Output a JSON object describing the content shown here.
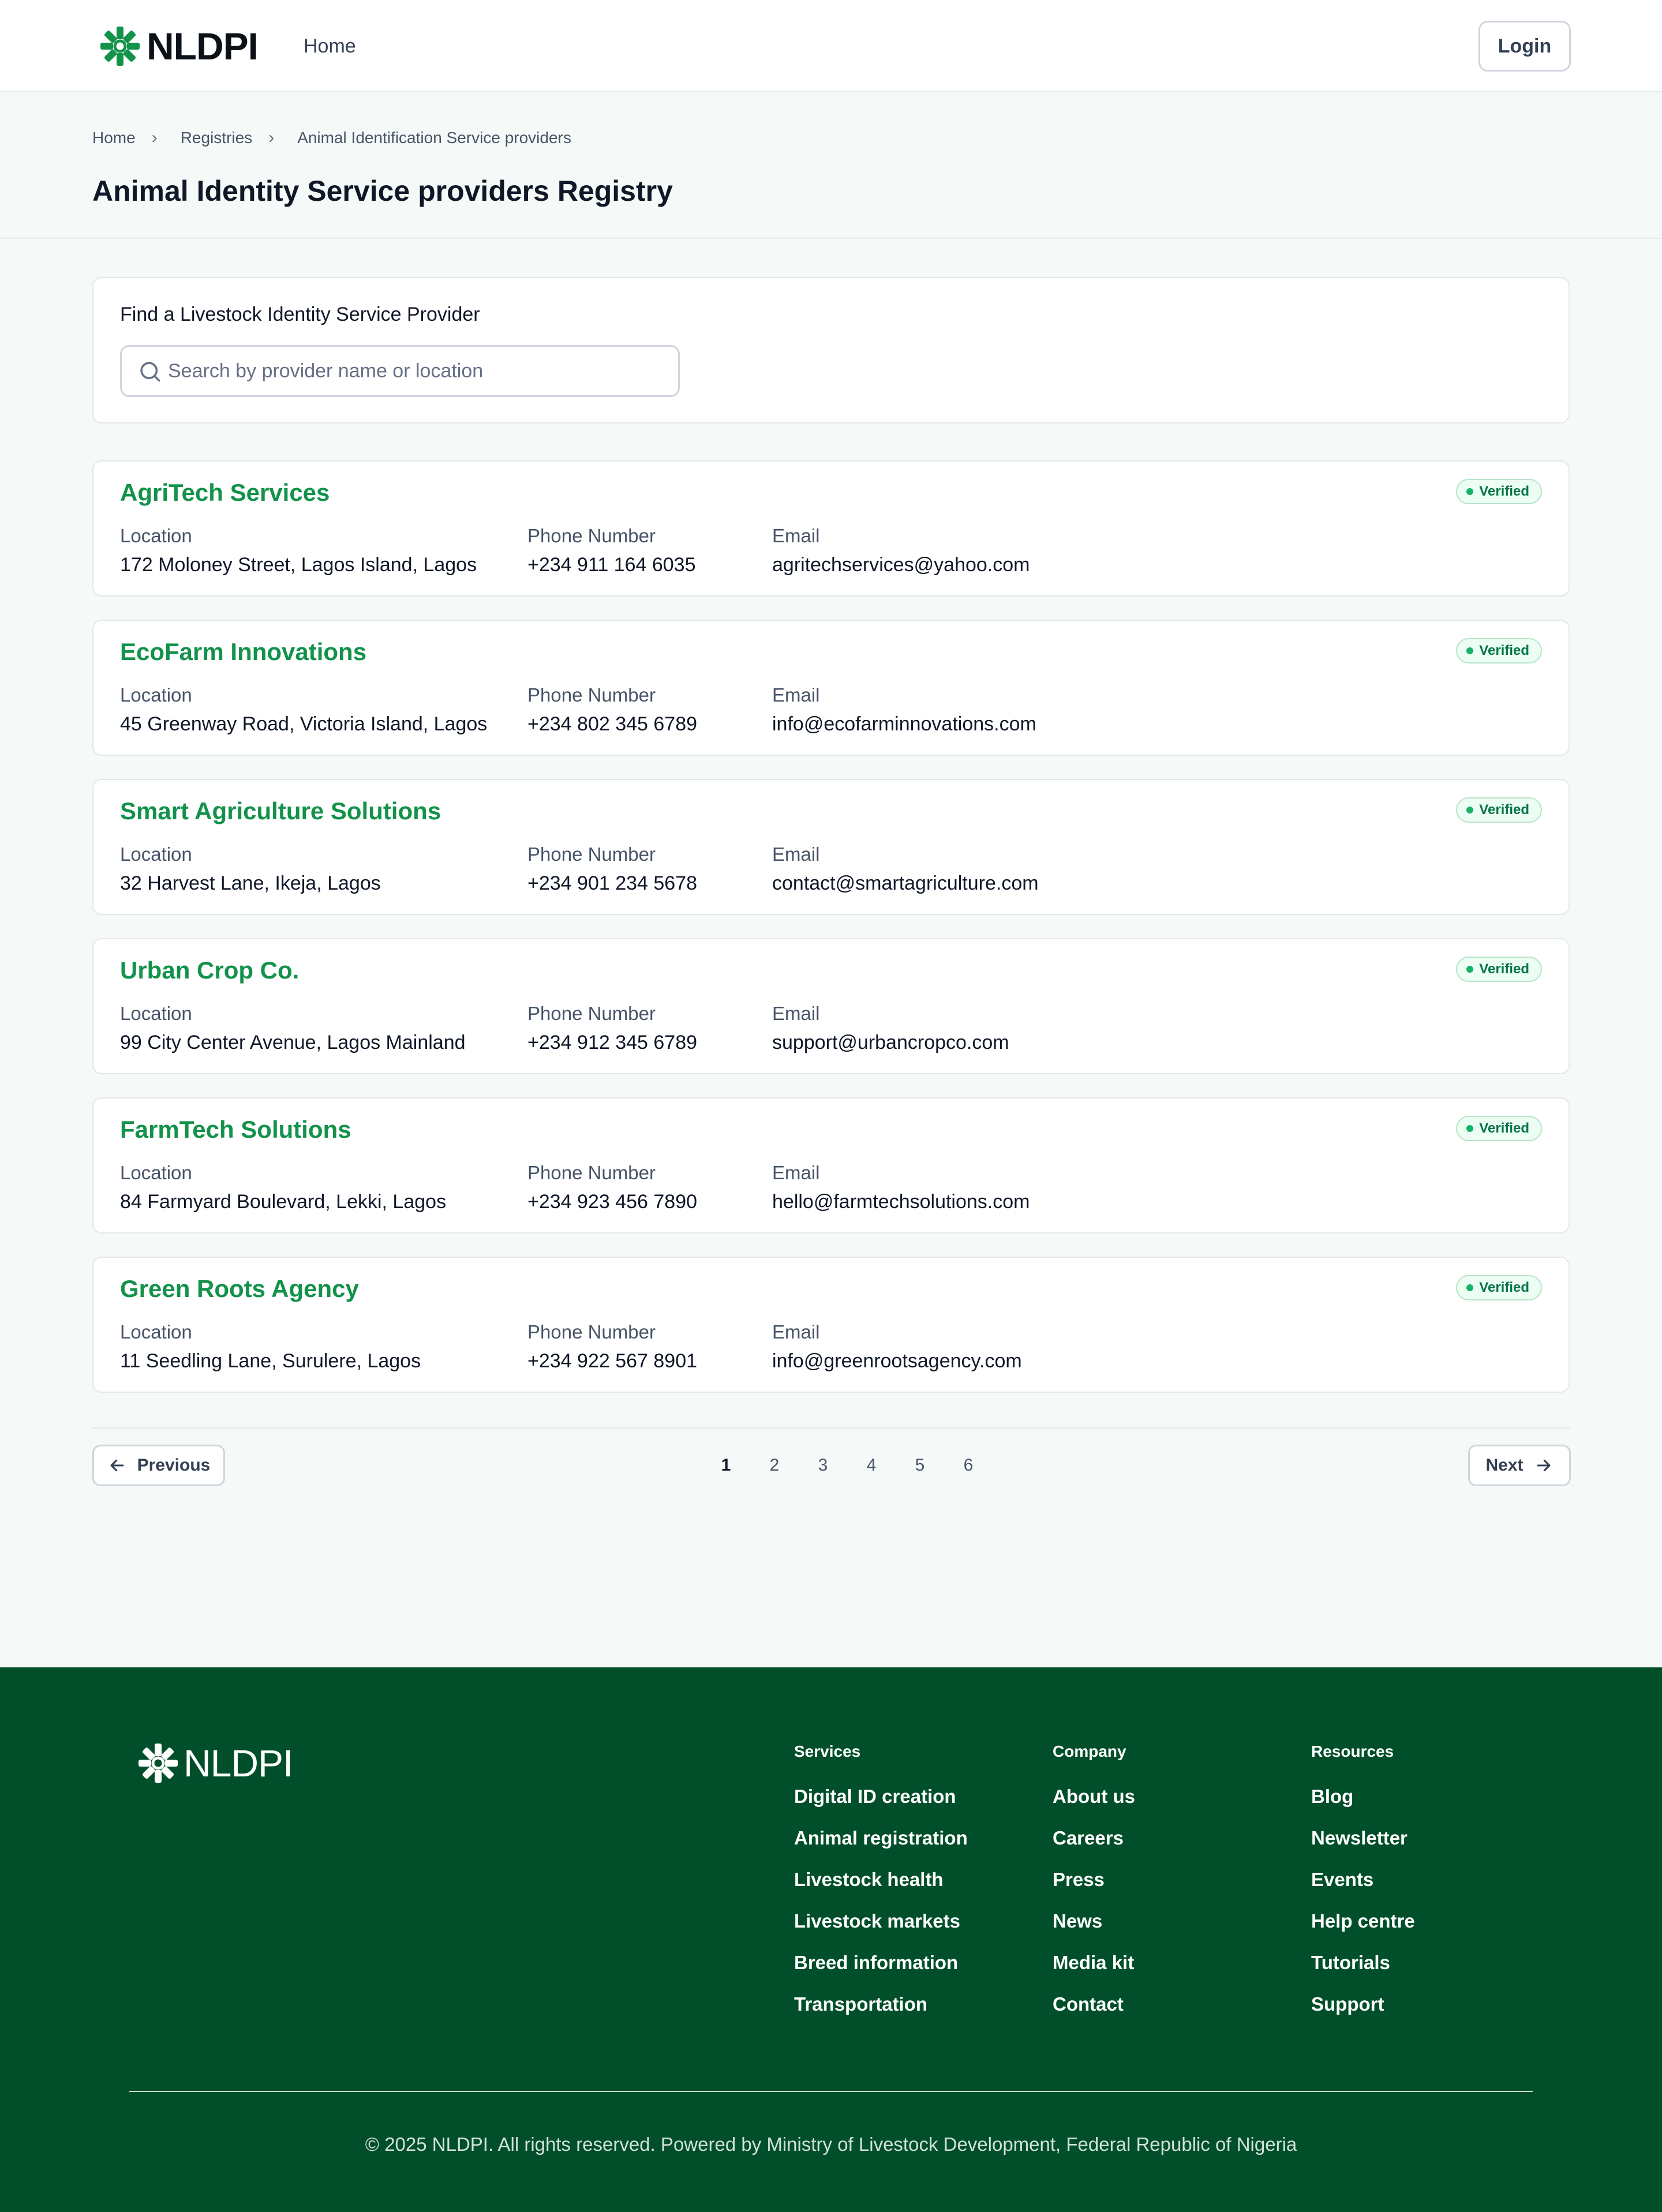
{
  "brand": {
    "name": "NLDPI",
    "accent": "#12924a",
    "footer_bg": "#004f2a"
  },
  "header": {
    "nav_home": "Home",
    "login": "Login"
  },
  "breadcrumb": [
    "Home",
    "Registries",
    "Animal Identification Service providers"
  ],
  "page_title": "Animal Identity Service providers Registry",
  "search": {
    "label": "Find a Livestock Identity Service Provider",
    "placeholder": "Search by provider name or location",
    "value": ""
  },
  "field_labels": {
    "location": "Location",
    "phone": "Phone Number",
    "email": "Email"
  },
  "providers": [
    {
      "name": "AgriTech Services",
      "status": "Verified",
      "location": "172 Moloney Street, Lagos Island, Lagos",
      "phone": "+234 911 164 6035",
      "email": "agritechservices@yahoo.com"
    },
    {
      "name": "EcoFarm Innovations",
      "status": "Verified",
      "location": "45 Greenway Road, Victoria Island, Lagos",
      "phone": "+234 802 345 6789",
      "email": "info@ecofarminnovations.com"
    },
    {
      "name": "Smart Agriculture Solutions",
      "status": "Verified",
      "location": "32 Harvest Lane, Ikeja, Lagos",
      "phone": "+234 901 234 5678",
      "email": "contact@smartagriculture.com"
    },
    {
      "name": "Urban Crop Co.",
      "status": "Verified",
      "location": "99 City Center Avenue, Lagos Mainland",
      "phone": "+234 912 345 6789",
      "email": "support@urbancropco.com"
    },
    {
      "name": "FarmTech Solutions",
      "status": "Verified",
      "location": "84 Farmyard Boulevard, Lekki, Lagos",
      "phone": "+234 923 456 7890",
      "email": "hello@farmtechsolutions.com"
    },
    {
      "name": "Green Roots Agency",
      "status": "Verified",
      "location": "11 Seedling Lane, Surulere, Lagos",
      "phone": "+234 922 567 8901",
      "email": "info@greenrootsagency.com"
    }
  ],
  "pagination": {
    "previous": "Previous",
    "next": "Next",
    "pages": [
      "1",
      "2",
      "3",
      "4",
      "5",
      "6"
    ],
    "current": "1"
  },
  "footer": {
    "columns": [
      {
        "title": "Services",
        "links": [
          "Digital ID creation",
          "Animal registration",
          "Livestock health",
          "Livestock markets",
          "Breed information",
          "Transportation"
        ]
      },
      {
        "title": "Company",
        "links": [
          "About us",
          "Careers",
          "Press",
          "News",
          "Media kit",
          "Contact"
        ]
      },
      {
        "title": "Resources",
        "links": [
          "Blog",
          "Newsletter",
          "Events",
          "Help centre",
          "Tutorials",
          "Support"
        ]
      }
    ],
    "copyright": "© 2025 NLDPI. All rights reserved. Powered by Ministry of Livestock Development, Federal Republic of Nigeria"
  }
}
